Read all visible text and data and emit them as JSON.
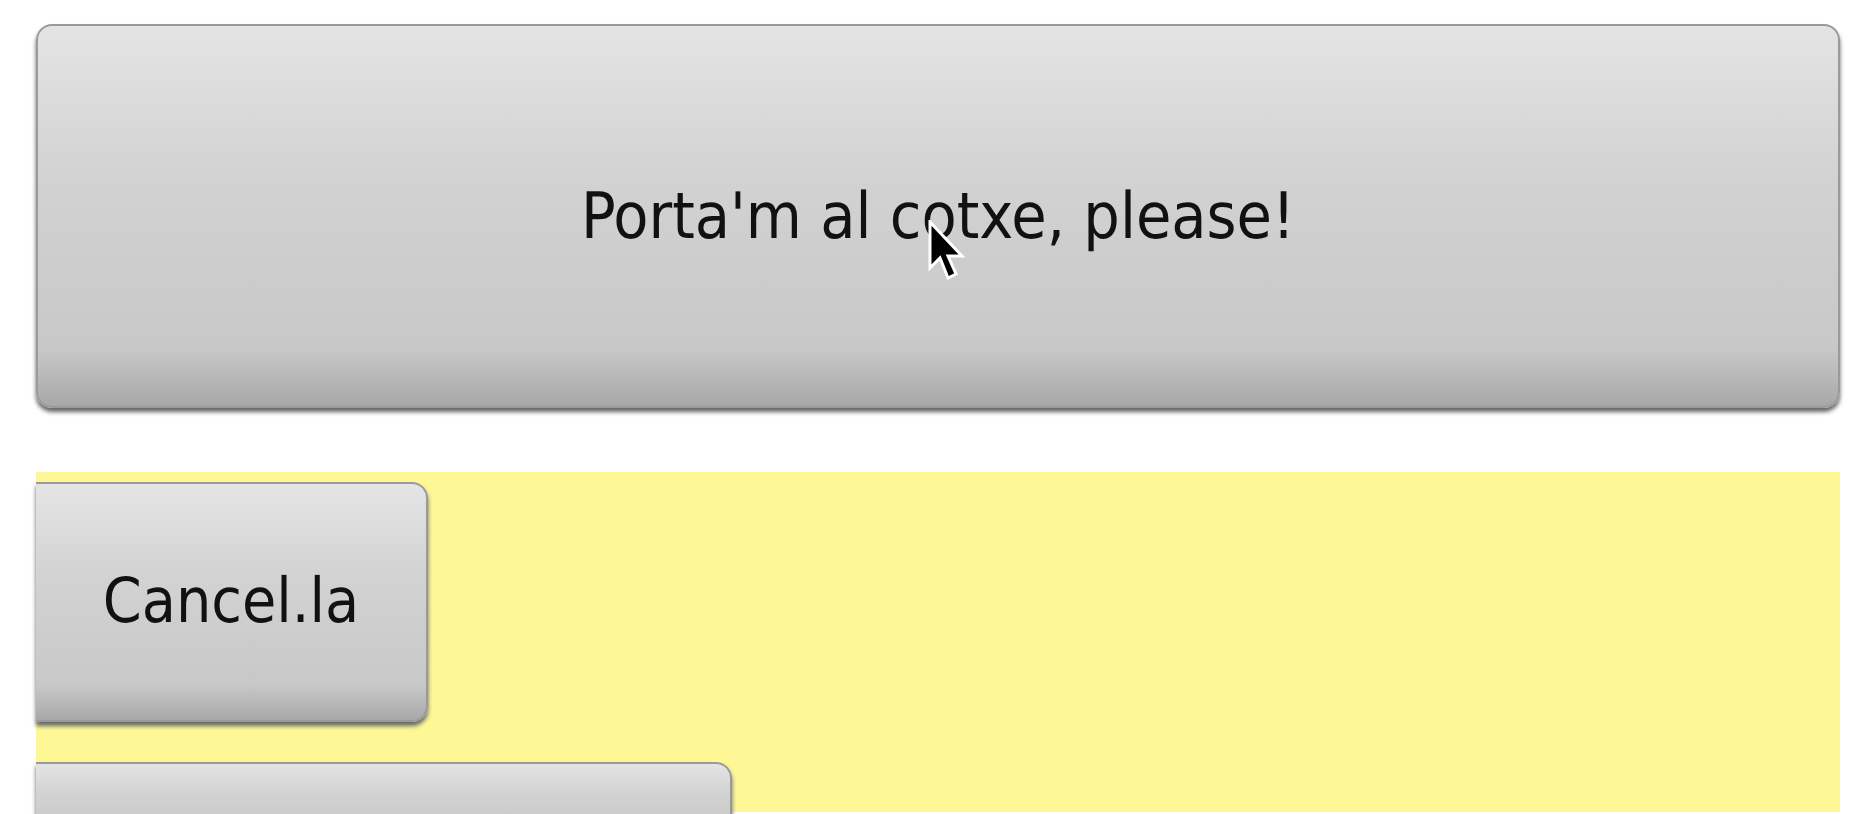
{
  "buttons": [
    {
      "label": "Porta'm al cotxe, please!",
      "kind": "wide"
    }
  ],
  "panel": {
    "buttons": [
      {
        "label": "Cancel.la",
        "kind": "button"
      },
      {
        "kind": "blank"
      }
    ]
  }
}
